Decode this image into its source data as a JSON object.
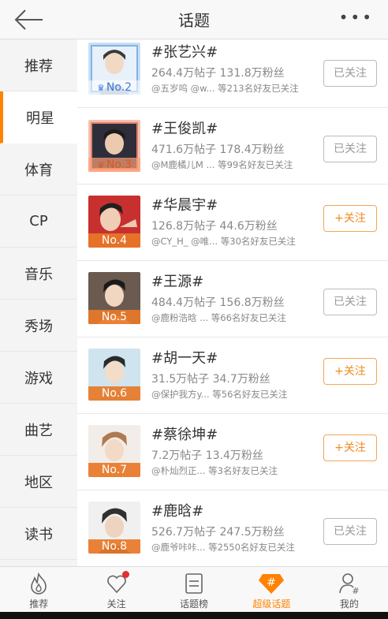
{
  "header": {
    "title": "话题",
    "more_label": "•••"
  },
  "sidebar": {
    "items": [
      {
        "label": "推荐"
      },
      {
        "label": "明星"
      },
      {
        "label": "体育"
      },
      {
        "label": "CP"
      },
      {
        "label": "音乐"
      },
      {
        "label": "秀场"
      },
      {
        "label": "游戏"
      },
      {
        "label": "曲艺"
      },
      {
        "label": "地区"
      },
      {
        "label": "读书"
      }
    ],
    "active_index": 1
  },
  "topics": [
    {
      "title": "#张艺兴#",
      "stats": "264.4万帖子  131.8万粉丝",
      "friends": "@五岁呜 @w... 等213名好友已关注",
      "rank": "No.2",
      "button": "已关注",
      "followed": true,
      "accent": "#7fb4e6"
    },
    {
      "title": "#王俊凯#",
      "stats": "471.6万帖子  178.4万粉丝",
      "friends": "@M鹿橘儿M ... 等99名好友已关注",
      "rank": "No.3",
      "button": "已关注",
      "followed": true,
      "accent": "#e0806a"
    },
    {
      "title": "#华晨宇#",
      "stats": "126.8万帖子  44.6万粉丝",
      "friends": "@CY_H_ @唯... 等30名好友已关注",
      "rank": "No.4",
      "button": "+关注",
      "followed": false,
      "accent": "#d04040"
    },
    {
      "title": "#王源#",
      "stats": "484.4万帖子  156.8万粉丝",
      "friends": "@鹿粉浩晗 ... 等66名好友已关注",
      "rank": "No.5",
      "button": "已关注",
      "followed": true,
      "accent": "#6a5a50"
    },
    {
      "title": "#胡一天#",
      "stats": "31.5万帖子  34.7万粉丝",
      "friends": "@保护我方y... 等56名好友已关注",
      "rank": "No.6",
      "button": "+关注",
      "followed": false,
      "accent": "#9fc7d8"
    },
    {
      "title": "#蔡徐坤#",
      "stats": "7.2万帖子  13.4万粉丝",
      "friends": "@朴灿烈正... 等3名好友已关注",
      "rank": "No.7",
      "button": "+关注",
      "followed": false,
      "accent": "#e8e0d8"
    },
    {
      "title": "#鹿晗#",
      "stats": "526.7万帖子  247.5万粉丝",
      "friends": "@鹿爷咔咔... 等2550名好友已关注",
      "rank": "No.8",
      "button": "已关注",
      "followed": true,
      "accent": "#d8d8d8"
    }
  ],
  "tabbar": {
    "items": [
      {
        "label": "推荐",
        "icon": "fire-icon"
      },
      {
        "label": "关注",
        "icon": "heart-icon"
      },
      {
        "label": "话题榜",
        "icon": "list-icon"
      },
      {
        "label": "超级话题",
        "icon": "hashtag-diamond-icon"
      },
      {
        "label": "我的",
        "icon": "user-icon"
      }
    ],
    "active_index": 3
  },
  "colors": {
    "accent": "#ff8200",
    "follow_text": "#f08a1f",
    "badge": "#e03030"
  }
}
